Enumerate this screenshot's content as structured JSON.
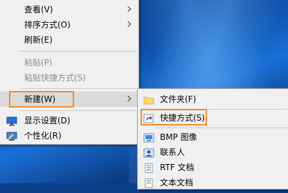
{
  "context_menu": {
    "items": [
      {
        "label": "查看(V)"
      },
      {
        "label": "排序方式(O)"
      },
      {
        "label": "刷新(E)"
      },
      {
        "label": "粘贴(P)"
      },
      {
        "label": "粘贴快捷方式(S)"
      },
      {
        "label": "新建(W)"
      },
      {
        "label": "显示设置(D)"
      },
      {
        "label": "个性化(R)"
      }
    ]
  },
  "new_submenu": {
    "items": [
      {
        "label": "文件夹(F)",
        "icon": "folder-icon"
      },
      {
        "label": "快捷方式(S)",
        "icon": "shortcut-icon"
      },
      {
        "label": "BMP 图像",
        "icon": "bmp-image-icon"
      },
      {
        "label": "联系人",
        "icon": "contact-icon"
      },
      {
        "label": "RTF 文档",
        "icon": "rtf-document-icon"
      },
      {
        "label": "文本文档",
        "icon": "text-document-icon"
      }
    ]
  },
  "colors": {
    "menu_bg": "#f0f0f0",
    "hover_bg": "#dadada",
    "highlight_border": "#f08c2a",
    "disabled_text": "#8d8d8d"
  }
}
